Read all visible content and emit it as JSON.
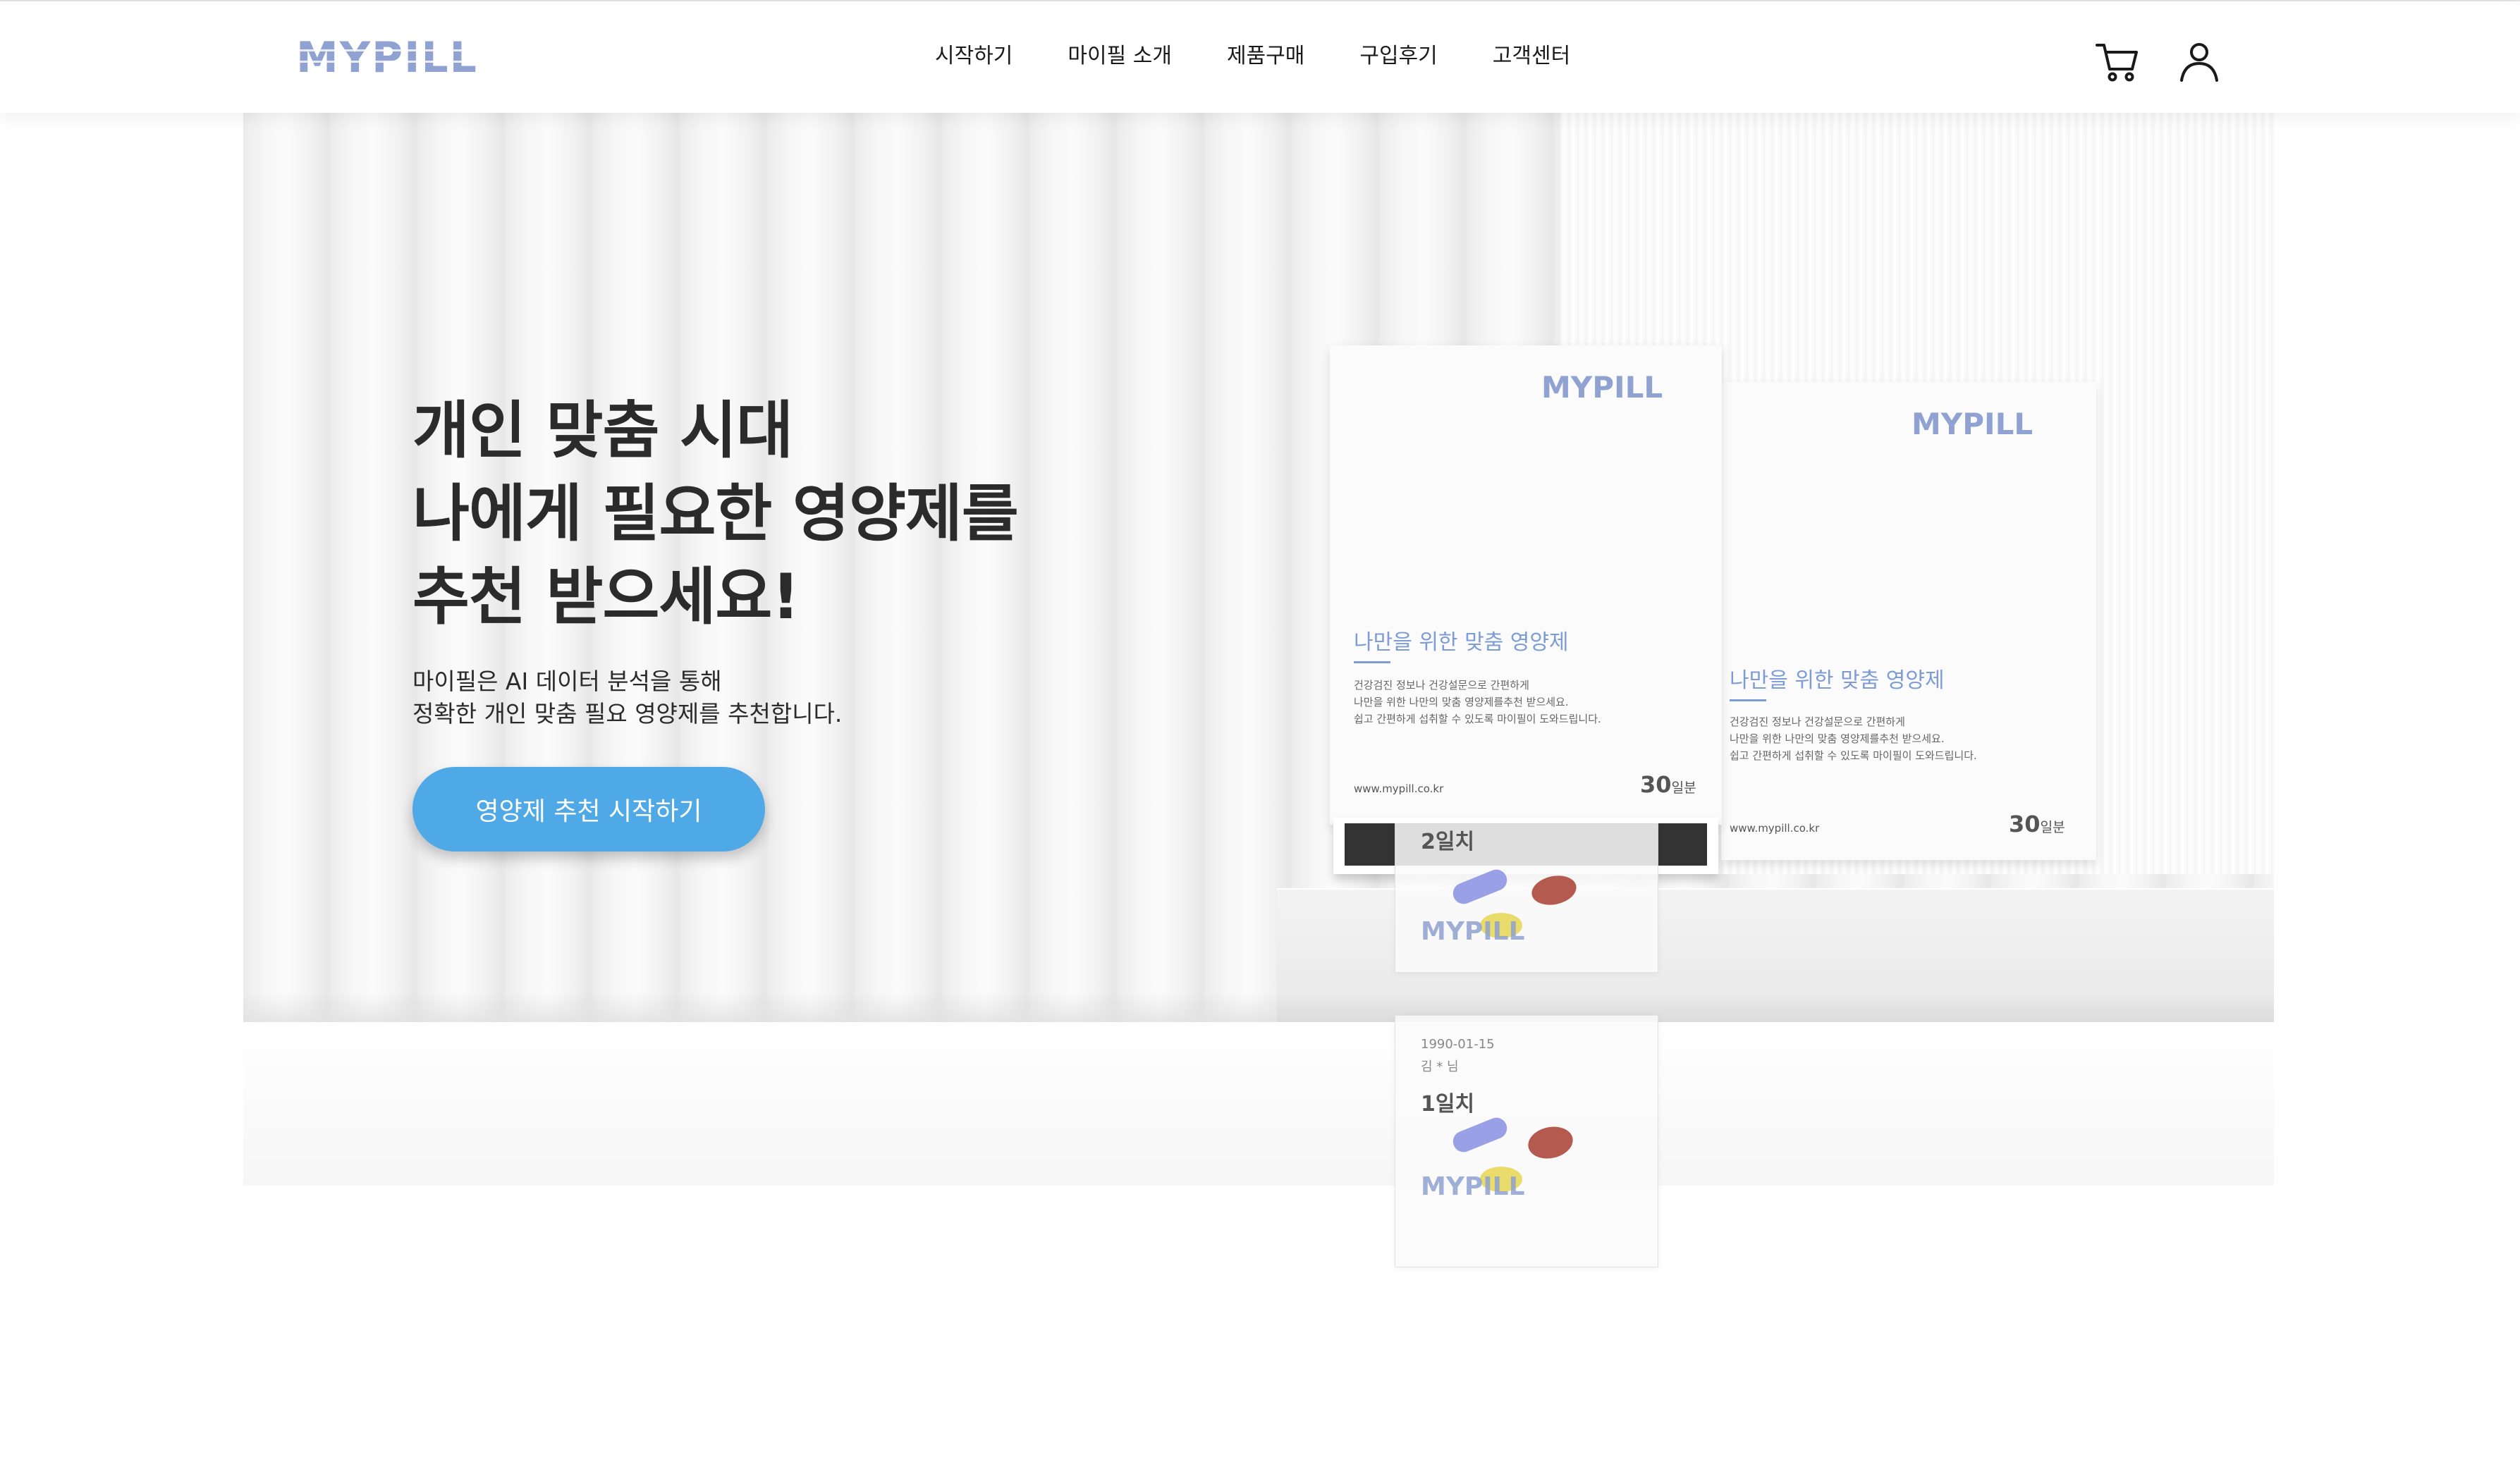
{
  "brand": {
    "logo_text": "MYPILL",
    "logo_color": "#8fa2d1",
    "accent": "#4fa9e6"
  },
  "nav": {
    "items": [
      {
        "label": "시작하기"
      },
      {
        "label": "마이필 소개"
      },
      {
        "label": "제품구매"
      },
      {
        "label": "구입후기"
      },
      {
        "label": "고객센터"
      }
    ]
  },
  "header_icons": {
    "cart": "cart-icon",
    "user": "user-icon"
  },
  "hero": {
    "headline": [
      "개인 맞춤 시대",
      "나에게 필요한 영양제를",
      "추천 받으세요!"
    ],
    "subtext": [
      "마이필은 AI 데이터 분석을 통해",
      "정확한 개인 맞춤 필요 영양제를 추천합니다."
    ],
    "cta_label": "영양제 추천 시작하기"
  },
  "product": {
    "box_logo": "MYPILL",
    "box_title": "나만을 위한 맞춤 영양제",
    "box_desc": [
      "건강검진 정보나 건강설문으로 간편하게",
      "나만을 위한 나만의 맞춤 영양제를추천 받으세요.",
      "쉽고 간편하게 섭취할 수 있도록 마이필이 도와드립니다."
    ],
    "site": "www.mypill.co.kr",
    "days_number": "30",
    "days_unit": "일분"
  },
  "sachets": [
    {
      "day": "2일치",
      "logo": "MYPILL"
    },
    {
      "date": "1990-01-15",
      "name": "김 * 님",
      "day": "1일치",
      "logo": "MYPILL"
    }
  ]
}
